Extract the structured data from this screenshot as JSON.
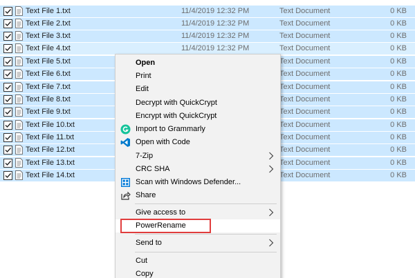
{
  "files": [
    {
      "name": "Text File 1.txt",
      "date": "11/4/2019 12:32 PM",
      "type": "Text Document",
      "size": "0 KB"
    },
    {
      "name": "Text File 2.txt",
      "date": "11/4/2019 12:32 PM",
      "type": "Text Document",
      "size": "0 KB"
    },
    {
      "name": "Text File 3.txt",
      "date": "11/4/2019 12:32 PM",
      "type": "Text Document",
      "size": "0 KB"
    },
    {
      "name": "Text File 4.txt",
      "date": "11/4/2019 12:32 PM",
      "type": "Text Document",
      "size": "0 KB"
    },
    {
      "name": "Text File 5.txt",
      "date": "",
      "type": "Text Document",
      "size": "0 KB"
    },
    {
      "name": "Text File 6.txt",
      "date": "",
      "type": "Text Document",
      "size": "0 KB"
    },
    {
      "name": "Text File 7.txt",
      "date": "",
      "type": "Text Document",
      "size": "0 KB"
    },
    {
      "name": "Text File 8.txt",
      "date": "",
      "type": "Text Document",
      "size": "0 KB"
    },
    {
      "name": "Text File 9.txt",
      "date": "",
      "type": "Text Document",
      "size": "0 KB"
    },
    {
      "name": "Text File 10.txt",
      "date": "",
      "type": "Text Document",
      "size": "0 KB"
    },
    {
      "name": "Text File 11.txt",
      "date": "",
      "type": "Text Document",
      "size": "0 KB"
    },
    {
      "name": "Text File 12.txt",
      "date": "",
      "type": "Text Document",
      "size": "0 KB"
    },
    {
      "name": "Text File 13.txt",
      "date": "",
      "type": "Text Document",
      "size": "0 KB"
    },
    {
      "name": "Text File 14.txt",
      "date": "",
      "type": "Text Document",
      "size": "0 KB"
    }
  ],
  "menu": {
    "open": "Open",
    "print": "Print",
    "edit": "Edit",
    "decrypt": "Decrypt with QuickCrypt",
    "encrypt": "Encrypt with QuickCrypt",
    "grammarly": "Import to Grammarly",
    "open_code": "Open with Code",
    "zip": "7-Zip",
    "crc": "CRC SHA",
    "defender": "Scan with Windows Defender...",
    "share": "Share",
    "give_access": "Give access to",
    "powerrename": "PowerRename",
    "send_to": "Send to",
    "cut": "Cut",
    "copy": "Copy"
  },
  "colors": {
    "selection": "#cce8ff",
    "menu_bg": "#f2f2f2",
    "highlight_border": "#e03c3c",
    "grammarly": "#15c39a",
    "vscode": "#007acc",
    "defender": "#0078d7"
  },
  "icons": {
    "submenu_arrow": "›"
  }
}
